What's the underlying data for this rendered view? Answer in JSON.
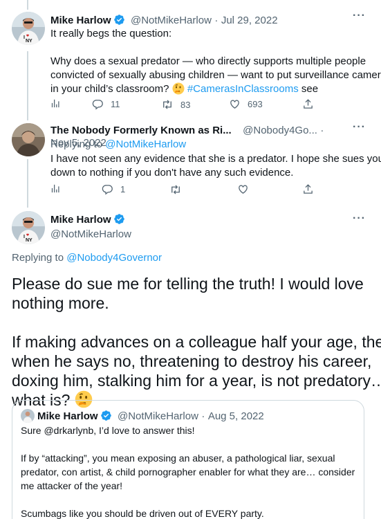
{
  "colors": {
    "accent": "#1d9bf0",
    "muted": "#536471",
    "text": "#0f1419",
    "border": "#cfd9de",
    "verified": "#1d9bf0"
  },
  "tweet1": {
    "name": "Mike Harlow",
    "handle": "@NotMikeHarlow",
    "dot": "·",
    "date": "Jul 29, 2022",
    "line1": "It really begs the question:",
    "line2": "Why does a sexual predator — who directly supports multiple people",
    "line3": "convicted of sexually abusing children — want to put surveillance cameras",
    "line4_pre": "in your child’s classroom?",
    "hashtag": "#CamerasInClassrooms",
    "line4_post": "see",
    "replies": "11",
    "retweets": "83",
    "likes": "693"
  },
  "tweet2": {
    "name": "The Nobody Formerly Known as Ri...",
    "handle": "@Nobody4Go...",
    "dot": "·",
    "date": "Nov 5, 2022",
    "replying_to_label": "Replying to",
    "replying_to_handle": "@NotMikeHarlow",
    "line1": "I have not seen any evidence that she is a predator.  I hope she sues you",
    "line2": "down to nothing if you don't have any such evidence.",
    "replies": "1"
  },
  "tweet3": {
    "name": "Mike Harlow",
    "handle": "@NotMikeHarlow",
    "replying_to_label": "Replying to",
    "replying_to_handle": "@Nobody4Governor",
    "p1_line1": "Please do sue me for telling the truth! I would love",
    "p1_line2": "nothing more.",
    "p2_line1": "If making advances on a colleague half your age, then",
    "p2_line2": "when he says no, threatening to destroy his career,",
    "p2_line3": "doxing him, stalking him for a year, is not predatory…",
    "p2_line4": "what is?"
  },
  "quote": {
    "name": "Mike Harlow",
    "handle": "@NotMikeHarlow",
    "dot": "·",
    "date": "Aug 5, 2022",
    "line1": "Sure @drkarlynb, I’d love to answer this!",
    "line2": "If by “attacking”, you mean exposing an abuser, a pathological liar, sexual",
    "line3": "predator, con artist, & child pornographer enabler for what they are… consider",
    "line4": "me attacker of the year!",
    "line5": "Scumbags like you should be driven out of EVERY party."
  },
  "icons": [
    "verified-badge-icon",
    "more-icon",
    "analytics-icon",
    "reply-icon",
    "retweet-icon",
    "like-icon",
    "share-icon",
    "thinking-face-emoji"
  ]
}
